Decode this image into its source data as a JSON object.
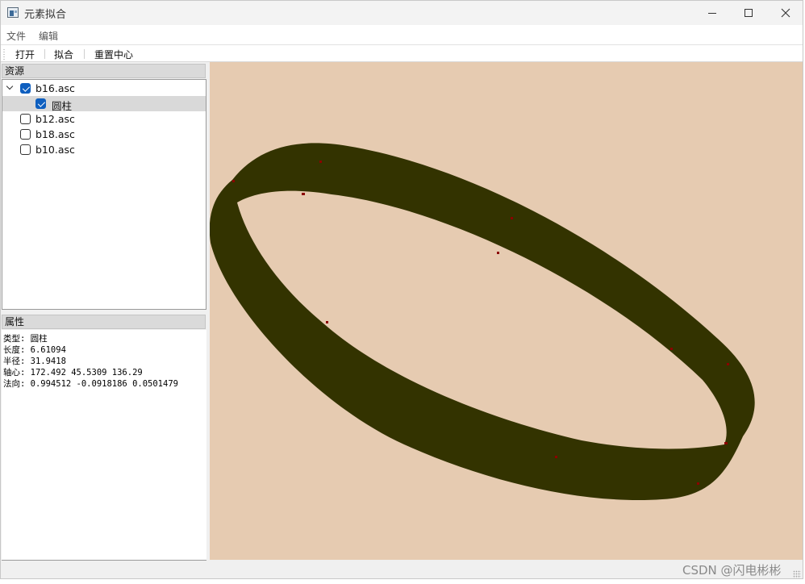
{
  "window": {
    "title": "元素拟合"
  },
  "menu": {
    "file": "文件",
    "edit": "编辑"
  },
  "toolbar": {
    "open": "打开",
    "fit": "拟合",
    "reset_center": "重置中心"
  },
  "resources": {
    "title": "资源",
    "items": [
      {
        "label": "b16.asc",
        "checked": true,
        "expanded": true
      },
      {
        "label": "圆柱",
        "checked": true,
        "child": true,
        "selected": true
      },
      {
        "label": "b12.asc",
        "checked": false
      },
      {
        "label": "b18.asc",
        "checked": false
      },
      {
        "label": "b10.asc",
        "checked": false
      }
    ]
  },
  "properties": {
    "title": "属性",
    "lines": [
      "类型: 圆柱",
      "长度: 6.61094",
      "半径: 31.9418",
      "轴心: 172.492 45.5309 136.29",
      "法向: 0.994512 -0.0918186 0.0501479"
    ]
  },
  "viewport": {
    "background": "#e6cbb1",
    "band_color": "#333300",
    "point_color": "#8b0000"
  },
  "watermark": "CSDN @闪电彬彬"
}
